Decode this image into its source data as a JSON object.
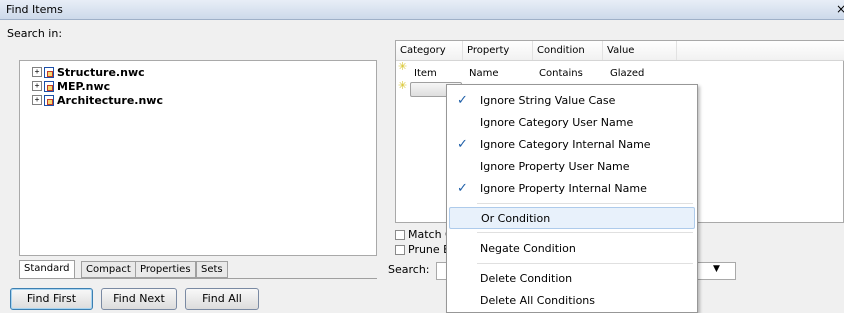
{
  "window": {
    "title": "Find Items",
    "close_glyph": "×"
  },
  "search_in": {
    "label": "Search in:",
    "tree": [
      {
        "label": "Structure.nwc",
        "icon": "nwc-file-icon",
        "expander": "+"
      },
      {
        "label": "MEP.nwc",
        "icon": "nwc-file-icon",
        "expander": "+"
      },
      {
        "label": "Architecture.nwc",
        "icon": "nwc-file-icon",
        "expander": "+"
      }
    ]
  },
  "tabs": [
    {
      "label": "Standard",
      "active": true
    },
    {
      "label": "Compact",
      "active": false
    },
    {
      "label": "Properties",
      "active": false
    },
    {
      "label": "Sets",
      "active": false
    }
  ],
  "buttons": {
    "find_first": "Find First",
    "find_next": "Find Next",
    "find_all": "Find All"
  },
  "conditions": {
    "columns": [
      "Category",
      "Property",
      "Condition",
      "Value"
    ],
    "rows": [
      {
        "category": "Item",
        "property": "Name",
        "condition": "Contains",
        "value": "Glazed"
      },
      {
        "category": "",
        "property": "",
        "condition": "",
        "value": ""
      }
    ]
  },
  "options": {
    "match_label_partial": "Match C",
    "prune_label_partial": "Prune B",
    "search_label": "Search:"
  },
  "context_menu": {
    "items": [
      {
        "label": "Ignore String Value Case",
        "checked": true
      },
      {
        "label": "Ignore Category User Name",
        "checked": false
      },
      {
        "label": "Ignore Category Internal Name",
        "checked": true
      },
      {
        "label": "Ignore Property User Name",
        "checked": false
      },
      {
        "label": "Ignore Property Internal Name",
        "checked": true
      },
      {
        "label": "Or Condition",
        "checked": false,
        "highlighted": true
      },
      {
        "label": "Negate Condition",
        "checked": false
      },
      {
        "label": "Delete Condition",
        "checked": false
      },
      {
        "label": "Delete All Conditions",
        "checked": false
      }
    ],
    "check_glyph": "✓"
  },
  "colors": {
    "accent": "#1f5fa8",
    "highlight": "#e8f1fb"
  }
}
